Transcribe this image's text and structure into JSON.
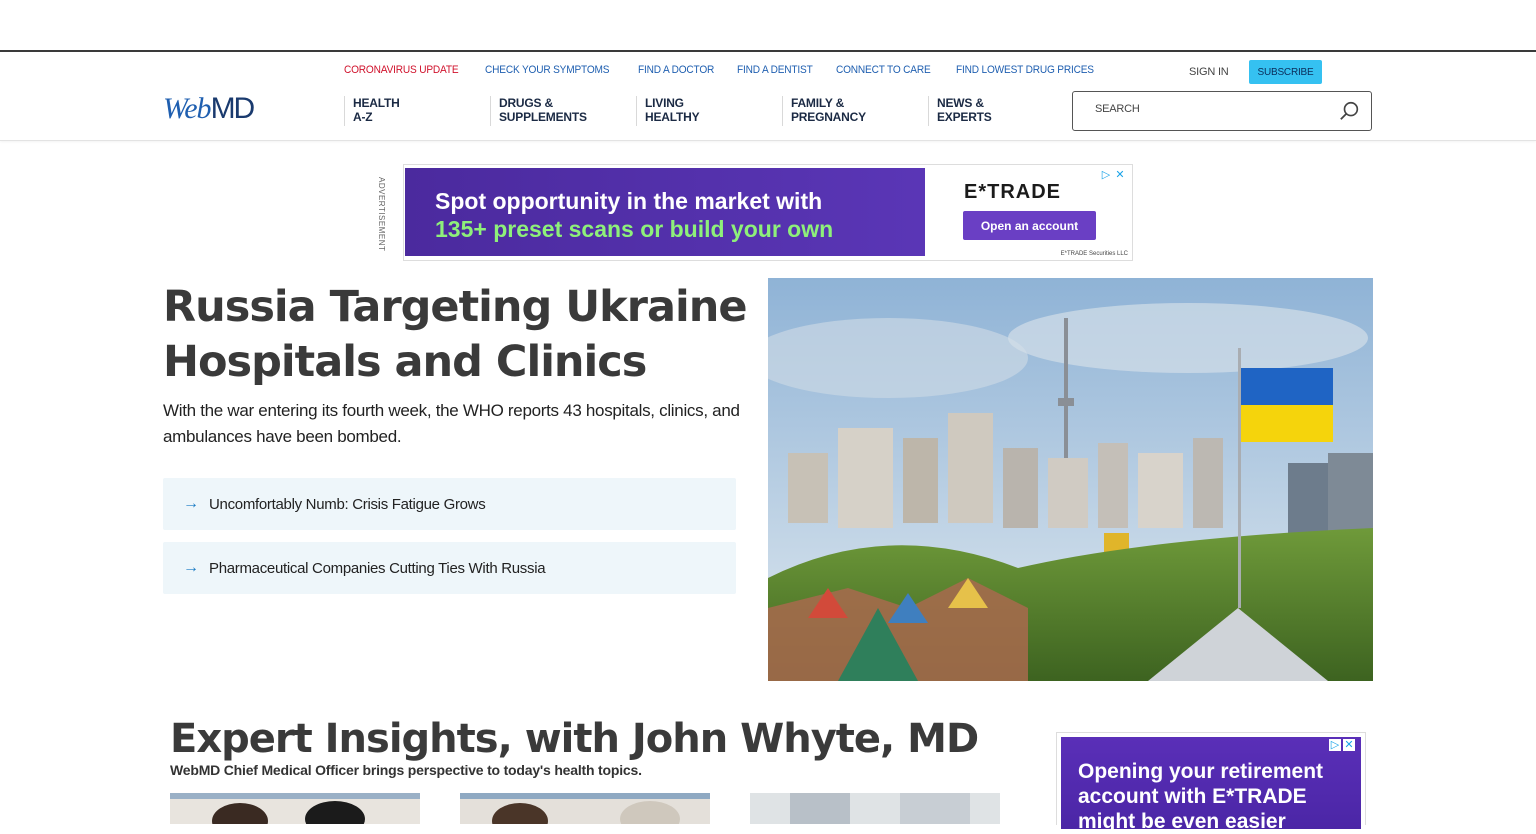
{
  "quicklinks": [
    {
      "label": "CORONAVIRUS UPDATE",
      "alert": true
    },
    {
      "label": "CHECK YOUR SYMPTOMS"
    },
    {
      "label": "FIND A DOCTOR"
    },
    {
      "label": "FIND A DENTIST"
    },
    {
      "label": "CONNECT TO CARE"
    },
    {
      "label": "FIND LOWEST DRUG PRICES"
    }
  ],
  "account": {
    "sign_in": "SIGN IN",
    "subscribe": "SUBSCRIBE"
  },
  "logo": {
    "web": "Web",
    "md": "MD"
  },
  "nav": [
    {
      "line1": "HEALTH",
      "line2": "A-Z"
    },
    {
      "line1": "DRUGS &",
      "line2": "SUPPLEMENTS"
    },
    {
      "line1": "LIVING",
      "line2": "HEALTHY"
    },
    {
      "line1": "FAMILY &",
      "line2": "PREGNANCY"
    },
    {
      "line1": "NEWS &",
      "line2": "EXPERTS"
    }
  ],
  "search": {
    "placeholder": "SEARCH"
  },
  "ad_top": {
    "label": "ADVERTISEMENT",
    "line1": "Spot opportunity in the market with",
    "line2": "135+ preset scans or build your own",
    "brand": "E*TRADE",
    "cta": "Open an account",
    "fineprint": "E*TRADE Securities LLC"
  },
  "lead": {
    "headline": "Russia Targeting Ukraine Hospitals and Clinics",
    "dek": "With the war entering its fourth week, the WHO reports 43 hospitals, clinics, and ambulances have been bombed.",
    "related": [
      "Uncomfortably Numb: Crisis Fatigue Grows",
      "Pharmaceutical Companies Cutting Ties With Russia"
    ]
  },
  "expert": {
    "title": "Expert Insights, with John Whyte, MD",
    "subtitle": "WebMD Chief Medical Officer brings perspective to today's health topics."
  },
  "ad_side": {
    "text": "Opening your retirement account with E*TRADE might be even easier"
  },
  "colors": {
    "link": "#1f5fb0",
    "alert": "#d0122c",
    "subscribe": "#35c1f1",
    "related_bg": "#eef6fa"
  }
}
